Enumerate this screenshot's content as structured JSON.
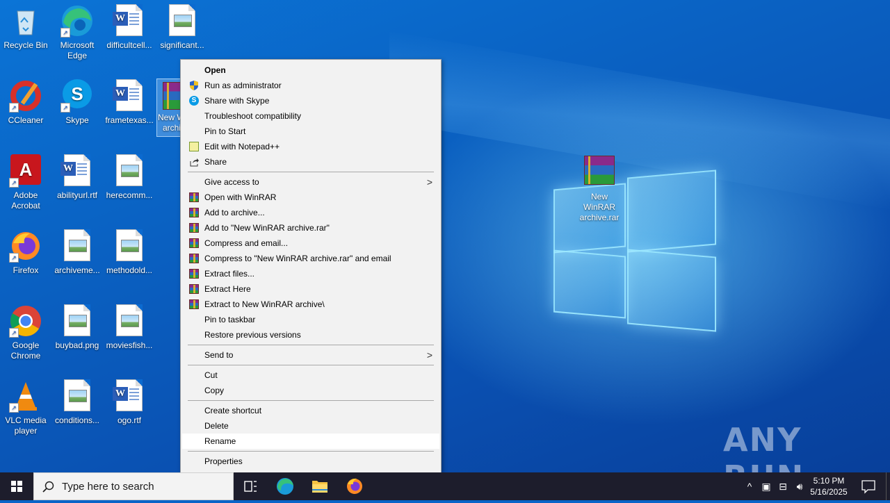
{
  "desktop": {
    "icons": [
      {
        "label": "Recycle Bin"
      },
      {
        "label": "Microsoft Edge"
      },
      {
        "label": "difficultcell..."
      },
      {
        "label": "significant..."
      },
      {
        "label": "CCleaner"
      },
      {
        "label": "Skype"
      },
      {
        "label": "frametexas..."
      },
      {
        "label": "New WinRAR archive.rar"
      },
      {
        "label": "Adobe Acrobat"
      },
      {
        "label": "abilityurl.rtf"
      },
      {
        "label": "herecomm..."
      },
      {
        "label": "Firefox"
      },
      {
        "label": "archiveme..."
      },
      {
        "label": "methodold..."
      },
      {
        "label": "Google Chrome"
      },
      {
        "label": "buybad.png"
      },
      {
        "label": "moviesfish..."
      },
      {
        "label": "VLC media player"
      },
      {
        "label": "conditions..."
      },
      {
        "label": "ogo.rtf"
      },
      {
        "label": "New WinRAR archive.rar"
      }
    ],
    "selected_icon_partial": {
      "line1": "New W",
      "line2": "archi"
    }
  },
  "context_menu": {
    "items": [
      {
        "label": "Open"
      },
      {
        "label": "Run as administrator"
      },
      {
        "label": "Share with Skype"
      },
      {
        "label": "Troubleshoot compatibility"
      },
      {
        "label": "Pin to Start"
      },
      {
        "label": "Edit with Notepad++"
      },
      {
        "label": "Share"
      },
      {
        "label": "Give access to"
      },
      {
        "label": "Open with WinRAR"
      },
      {
        "label": "Add to archive..."
      },
      {
        "label": "Add to \"New WinRAR archive.rar\""
      },
      {
        "label": "Compress and email..."
      },
      {
        "label": "Compress to \"New WinRAR archive.rar\" and email"
      },
      {
        "label": "Extract files..."
      },
      {
        "label": "Extract Here"
      },
      {
        "label": "Extract to New WinRAR archive\\"
      },
      {
        "label": "Pin to taskbar"
      },
      {
        "label": "Restore previous versions"
      },
      {
        "label": "Send to"
      },
      {
        "label": "Cut"
      },
      {
        "label": "Copy"
      },
      {
        "label": "Create shortcut"
      },
      {
        "label": "Delete"
      },
      {
        "label": "Rename"
      },
      {
        "label": "Properties"
      }
    ],
    "hovered": "Rename"
  },
  "taskbar": {
    "search_placeholder": "Type here to search",
    "time": "5:10 PM",
    "date": "5/16/2025"
  },
  "watermark": "ANY RUN"
}
